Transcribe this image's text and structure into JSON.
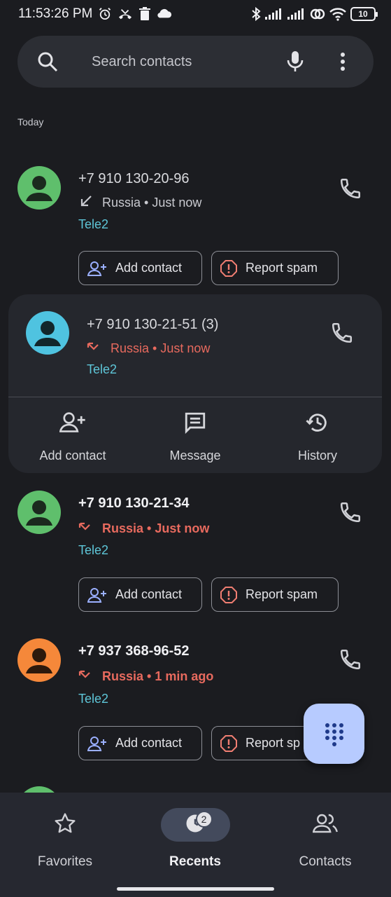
{
  "status_bar": {
    "time": "11:53:26 PM",
    "battery": "10",
    "icons": [
      "alarm-icon",
      "missed-call-icon",
      "trash-icon",
      "cloud-icon",
      "bluetooth-icon",
      "signal-icon",
      "signal-icon",
      "hotspot-icon",
      "wifi-icon",
      "battery-icon"
    ]
  },
  "search": {
    "placeholder": "Search contacts"
  },
  "section_label": "Today",
  "calls": [
    {
      "number": "+7 910 130-20-96",
      "detail": "Russia • Just now",
      "carrier": "Tele2",
      "type": "outgoing",
      "avatar_color": "#5fbf6c",
      "add_label": "Add contact",
      "spam_label": "Report spam"
    },
    {
      "number": "+7 910 130-21-51  (3)",
      "detail": "Russia • Just now",
      "carrier": "Tele2",
      "type": "missed",
      "avatar_color": "#4fc3e0"
    },
    {
      "number": "+7 910 130-21-34",
      "detail": "Russia • Just now",
      "carrier": "Tele2",
      "type": "missed",
      "avatar_color": "#5fbf6c",
      "add_label": "Add contact",
      "spam_label": "Report spam"
    },
    {
      "number": "+7 937 368-96-52",
      "detail": "Russia • 1 min ago",
      "carrier": "Tele2",
      "type": "missed",
      "avatar_color": "#f5883a",
      "add_label": "Add contact",
      "spam_label": "Report sp"
    }
  ],
  "expanded_actions": {
    "add": "Add contact",
    "message": "Message",
    "history": "History"
  },
  "nav": {
    "favorites": "Favorites",
    "recents": "Recents",
    "contacts": "Contacts",
    "recents_badge": "2"
  },
  "colors": {
    "background": "#1b1c20",
    "missed": "#e86a5e",
    "carrier": "#5ec6d8",
    "fab": "#b7cbff"
  }
}
